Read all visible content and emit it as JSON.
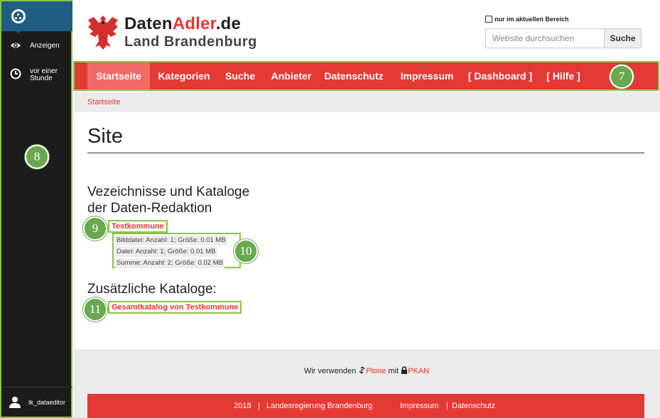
{
  "sidebar": {
    "items": [
      {
        "label": "Anzeigen",
        "icon": "eye-icon"
      },
      {
        "label_line1": "vor einer",
        "label_line2": "Stunde",
        "icon": "clock-icon"
      }
    ],
    "user": {
      "name": "tk_dataeditor",
      "icon": "user-icon"
    }
  },
  "header": {
    "brand_part1": "Daten",
    "brand_part2": "Adler",
    "brand_part3": ".de",
    "subtitle": "Land Brandenburg",
    "logo": "eagle-icon"
  },
  "search": {
    "scope_label": "nur im aktuellen Bereich",
    "placeholder": "Website durchsuchen",
    "button_label": "Suche"
  },
  "nav": {
    "items": [
      {
        "label": "Startseite",
        "active": true
      },
      {
        "label": "Kategorien"
      },
      {
        "label": "Suche"
      },
      {
        "label": "Anbieter"
      },
      {
        "label": "Datenschutz"
      },
      {
        "label": "Impressum"
      },
      {
        "label": "[ Dashboard ]"
      },
      {
        "label": "[ Hilfe ]"
      }
    ]
  },
  "breadcrumb": {
    "current": "Startseite"
  },
  "main": {
    "title": "Site",
    "section1_line1": "Vezeichnisse und Kataloge",
    "section1_line2": "der Daten-Redaktion",
    "catalog_link": "Testkommune",
    "stats": [
      "Bilddatei: Anzahl: 1; Größe: 0.01 MB",
      "Datei: Anzahl: 1; Größe: 0.01 MB",
      "Summe: Anzahl: 2; Größe: 0.02 MB"
    ],
    "section2": "Zusätzliche Kataloge:",
    "extra_link": "Gesamtkatalog von Testkommune"
  },
  "footer": {
    "text1": "Wir verwenden",
    "plone": "Plone",
    "text2": "mit",
    "pkan": "PKAN",
    "year": "2018",
    "sep": "|",
    "org": "Landesregierung Brandenburg",
    "impressum": "Impressum",
    "datenschutz": "Datenschutz"
  },
  "callouts": [
    "7",
    "8",
    "9",
    "10",
    "11"
  ],
  "colors": {
    "accent": "#e53935",
    "sidebar": "#1c1c1c",
    "sidebar_logo": "#1f5d82",
    "annotation": "#8bc34a"
  }
}
